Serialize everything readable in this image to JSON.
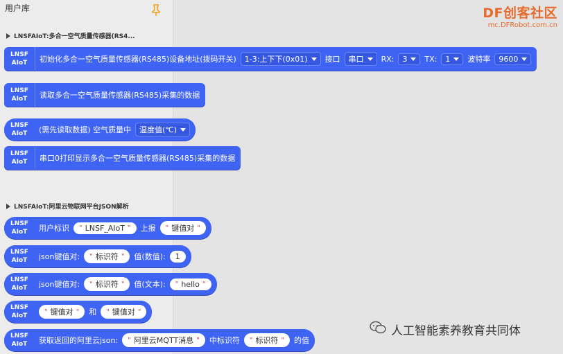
{
  "toolbox": {
    "title": "用户库",
    "pin_icon": "pin-icon"
  },
  "categories": [
    {
      "label": "LNSFAIoT:多合一空气质量传感器(RS4..."
    },
    {
      "label": "LNSFAIoT:阿里云物联网平台JSON解析"
    }
  ],
  "badge": {
    "line1": "LNSF",
    "line2": "AIoT"
  },
  "blocks": {
    "init": {
      "text": "初始化多合一空气质量传感器(RS485)设备地址(拨码开关)",
      "addr": "1-3:上下下(0x01)",
      "port_label": "接口",
      "port": "串口",
      "rx_label": "RX:",
      "rx": "3",
      "tx_label": "TX:",
      "tx": "1",
      "baud_label": "波特率",
      "baud": "9600"
    },
    "read": {
      "text": "读取多合一空气质量传感器(RS485)采集的数据"
    },
    "value": {
      "text": "(需先读取数据) 空气质量中",
      "field": "温度值(℃)"
    },
    "print": {
      "text": "串口0打印显示多合一空气质量传感器(RS485)采集的数据"
    },
    "report": {
      "label1": "用户标识",
      "str1": "LNSF_AIoT",
      "label2": "上报",
      "str2": "键值对"
    },
    "kv_num": {
      "label1": "json键值对:",
      "str1": "标识符",
      "label2": "值(数值):",
      "num": "1"
    },
    "kv_text": {
      "label1": "json键值对:",
      "str1": "标识符",
      "label2": "值(文本):",
      "str2": "hello"
    },
    "join": {
      "str1": "键值对",
      "label": "和",
      "str2": "键值对"
    },
    "get": {
      "label1": "获取返回的阿里云json:",
      "str1": "阿里云MQTT消息",
      "label2": "中标识符",
      "str2": "标识符",
      "label3": "的值"
    }
  },
  "quote_open": "\"",
  "quote_close": "\"",
  "logo": {
    "line1a": "DF",
    "line1b": "创客社区",
    "line2": "mc.DFRobot.com.cn"
  },
  "watermark": {
    "text": "人工智能素养教育共同体",
    "icon": "wechat-icon"
  },
  "colors": {
    "block": "#3f63f3",
    "accent": "#e66b2c"
  }
}
